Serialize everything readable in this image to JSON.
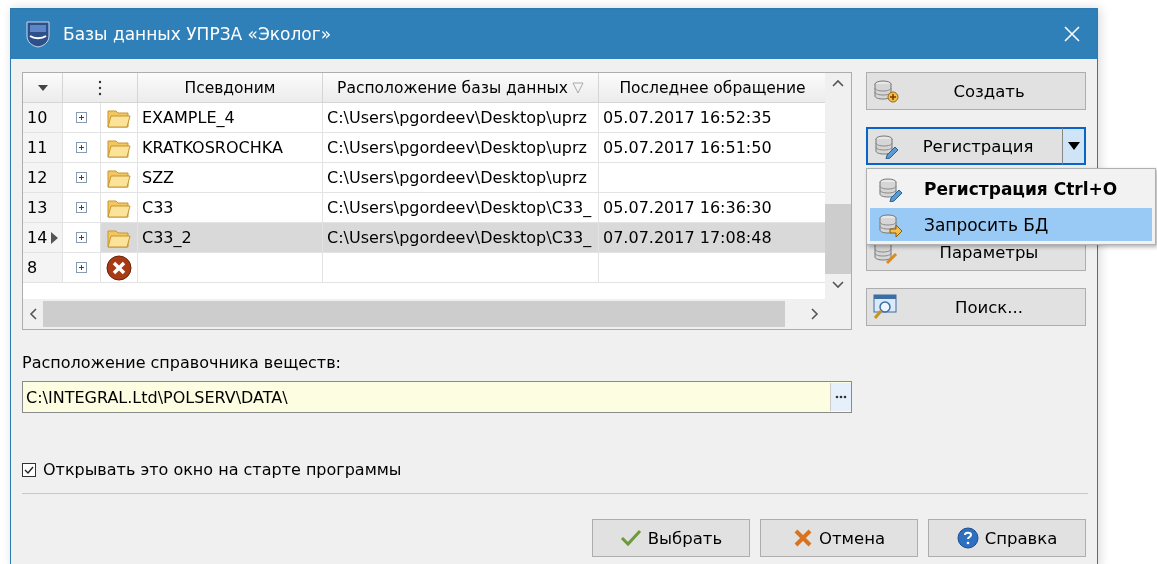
{
  "window": {
    "title": "Базы данных УПРЗА «Эколог»"
  },
  "table": {
    "columns": [
      {
        "label": "Псевдоним"
      },
      {
        "label": "Расположение базы данных",
        "filter": true
      },
      {
        "label": "Последнее обращение"
      }
    ],
    "rows": [
      {
        "number": "10",
        "current": false,
        "expanded": false,
        "kind": "folder",
        "alias": "EXAMPLE_4",
        "location": "C:\\Users\\pgordeev\\Desktop\\uprz",
        "last_access": "05.07.2017 16:52:35",
        "selected": false
      },
      {
        "number": "11",
        "current": false,
        "expanded": false,
        "kind": "folder",
        "alias": "KRATKOSROCHKA",
        "location": "C:\\Users\\pgordeev\\Desktop\\uprz",
        "last_access": "05.07.2017 16:51:50",
        "selected": false
      },
      {
        "number": "12",
        "current": false,
        "expanded": false,
        "kind": "folder",
        "alias": "SZZ",
        "location": "C:\\Users\\pgordeev\\Desktop\\uprz",
        "selected": false
      },
      {
        "number": "13",
        "current": false,
        "expanded": false,
        "kind": "folder",
        "alias": "C33",
        "location": "C:\\Users\\pgordeev\\Desktop\\C33_",
        "last_access": "05.07.2017 16:36:30",
        "selected": false
      },
      {
        "number": "14",
        "current": true,
        "expanded": false,
        "kind": "folder",
        "alias": "C33_2",
        "location": "C:\\Users\\pgordeev\\Desktop\\C33_",
        "last_access": "07.07.2017 17:08:48",
        "selected": true
      },
      {
        "number": "8",
        "current": false,
        "expanded": false,
        "kind": "error",
        "selected": false
      }
    ]
  },
  "side_buttons": [
    {
      "label": "Создать",
      "kind": "create",
      "split": false,
      "focused": false
    },
    {
      "label": "Регистрация",
      "kind": "register",
      "split": true,
      "focused": true
    },
    {
      "label": "Параметры",
      "kind": "params",
      "split": false,
      "focused": false
    },
    {
      "label": "Поиск...",
      "kind": "search",
      "split": false,
      "focused": false
    }
  ],
  "dropdown_menu": {
    "items": [
      {
        "label": "Регистрация Ctrl+O",
        "kind": "register",
        "default": true,
        "selected": false
      },
      {
        "label": "Запросить БД",
        "kind": "request",
        "default": false,
        "selected": true
      }
    ]
  },
  "substances_path": {
    "label": "Расположение справочника веществ:",
    "value": "C:\\INTEGRAL.Ltd\\POLSERV\\DATA\\"
  },
  "startup_checkbox": {
    "label": "Открывать это окно на старте программы",
    "checked": true
  },
  "footer_buttons": [
    {
      "label": "Выбрать",
      "kind": "ok"
    },
    {
      "label": "Отмена",
      "kind": "cancel"
    },
    {
      "label": "Справка",
      "kind": "help"
    }
  ]
}
